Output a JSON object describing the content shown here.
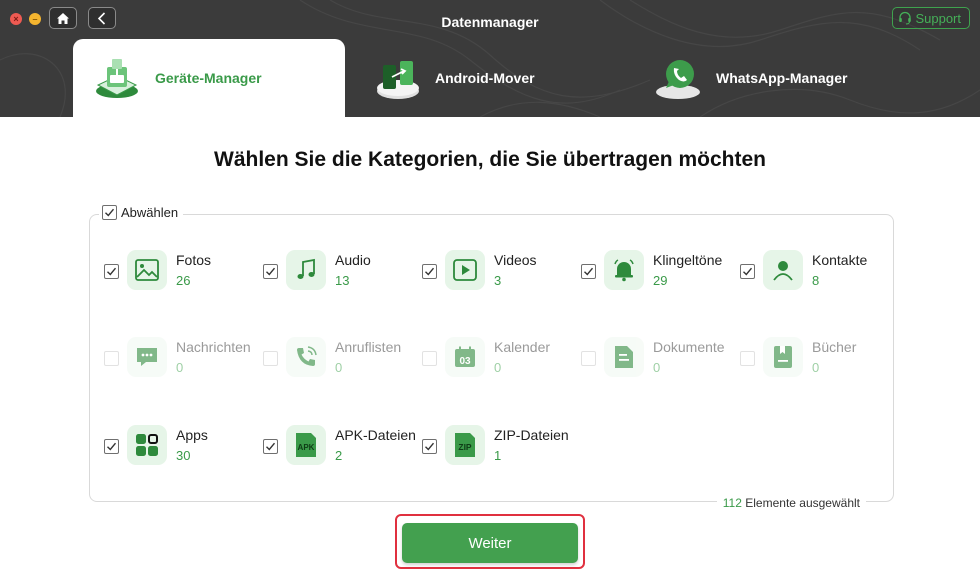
{
  "window": {
    "title": "Datenmanager",
    "support_label": "Support"
  },
  "tabs": [
    {
      "label": "Geräte-Manager",
      "active": true
    },
    {
      "label": "Android-Mover",
      "active": false
    },
    {
      "label": "WhatsApp-Manager",
      "active": false
    }
  ],
  "main": {
    "heading": "Wählen Sie die Kategorien, die Sie übertragen möchten",
    "select_all_label": "Abwählen",
    "select_all_checked": true,
    "categories": [
      {
        "name": "Fotos",
        "count": "26",
        "checked": true,
        "enabled": true,
        "icon": "image-icon"
      },
      {
        "name": "Audio",
        "count": "13",
        "checked": true,
        "enabled": true,
        "icon": "music-note-icon"
      },
      {
        "name": "Videos",
        "count": "3",
        "checked": true,
        "enabled": true,
        "icon": "play-icon"
      },
      {
        "name": "Klingeltöne",
        "count": "29",
        "checked": true,
        "enabled": true,
        "icon": "bell-icon"
      },
      {
        "name": "Kontakte",
        "count": "8",
        "checked": true,
        "enabled": true,
        "icon": "person-icon"
      },
      {
        "name": "Nachrichten",
        "count": "0",
        "checked": false,
        "enabled": false,
        "icon": "chat-bubble-icon"
      },
      {
        "name": "Anruflisten",
        "count": "0",
        "checked": false,
        "enabled": false,
        "icon": "phone-call-icon"
      },
      {
        "name": "Kalender",
        "count": "0",
        "checked": false,
        "enabled": false,
        "icon": "calendar-icon",
        "icon_text": "03"
      },
      {
        "name": "Dokumente",
        "count": "0",
        "checked": false,
        "enabled": false,
        "icon": "document-icon"
      },
      {
        "name": "Bücher",
        "count": "0",
        "checked": false,
        "enabled": false,
        "icon": "book-icon"
      },
      {
        "name": "Apps",
        "count": "30",
        "checked": true,
        "enabled": true,
        "icon": "apps-grid-icon"
      },
      {
        "name": "APK-Dateien",
        "count": "2",
        "checked": true,
        "enabled": true,
        "icon": "apk-file-icon",
        "icon_text": "APK"
      },
      {
        "name": "ZIP-Dateien",
        "count": "1",
        "checked": true,
        "enabled": true,
        "icon": "zip-file-icon",
        "icon_text": "ZIP"
      }
    ],
    "summary_count": "112",
    "summary_label": "Elemente ausgewählt",
    "next_label": "Weiter"
  },
  "colors": {
    "accent": "#43a04f",
    "header_bg": "#3b3b3b",
    "highlight": "#e0303f"
  }
}
